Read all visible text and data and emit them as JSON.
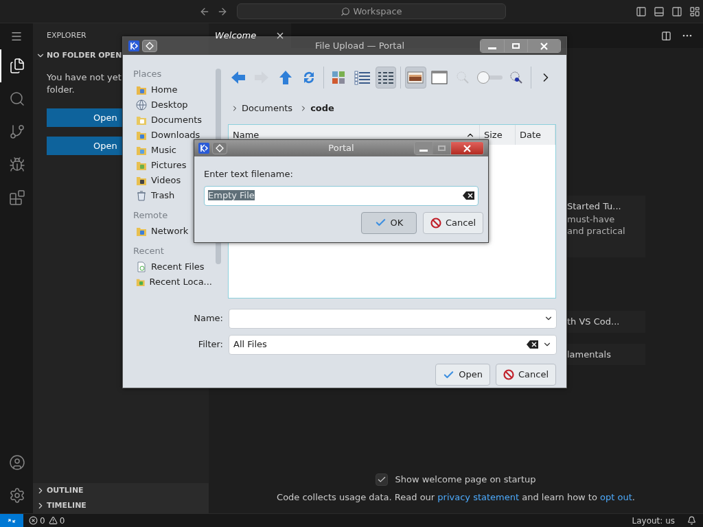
{
  "titlebar": {
    "search": "Workspace"
  },
  "activity_bar": {
    "top": [
      {
        "kind": "explorer",
        "selected": true
      },
      {
        "kind": "search",
        "selected": false
      },
      {
        "kind": "source-control",
        "selected": false
      },
      {
        "kind": "run-debug",
        "selected": false
      },
      {
        "kind": "extensions",
        "selected": false
      }
    ],
    "bottom": [
      {
        "kind": "accounts",
        "selected": false
      },
      {
        "kind": "manage",
        "selected": false
      }
    ]
  },
  "sidebar": {
    "title": "EXPLORER",
    "section": {
      "title": "NO FOLDER OPEN",
      "expanded": true
    },
    "message": "You have not yet folder.",
    "buttons": [
      "Open",
      "Open"
    ],
    "bottom_sections": [
      {
        "title": "OUTLINE",
        "expanded": false
      },
      {
        "title": "TIMELINE",
        "expanded": false
      }
    ]
  },
  "editor": {
    "tabs": [
      {
        "label": "Welcome",
        "selected": true
      }
    ],
    "cards": [
      {
        "title": "Started Tu...",
        "lines": [
          "must-have",
          "and practical"
        ]
      },
      {
        "title": "th VS Cod..."
      },
      {
        "title": "lamentals"
      }
    ],
    "startup_checkbox": {
      "label": "Show welcome page on startup",
      "checked": true
    },
    "footer": [
      {
        "text": "Code collects usage data. Read our ",
        "link": false
      },
      {
        "text": "privacy statement",
        "link": true
      },
      {
        "text": " and learn how to ",
        "link": false
      },
      {
        "text": "opt out",
        "link": true
      },
      {
        "text": ".",
        "link": false
      }
    ]
  },
  "status_bar": {
    "errors": "0",
    "warnings": "0",
    "layout": "Layout: us"
  },
  "file_dialog": {
    "title": "File Upload — Portal",
    "places": [
      {
        "title": "Places",
        "items": [
          {
            "label": "Home",
            "kind": "home"
          },
          {
            "label": "Desktop",
            "kind": "desktop"
          },
          {
            "label": "Documents",
            "kind": "documents"
          },
          {
            "label": "Downloads",
            "kind": "downloads"
          },
          {
            "label": "Music",
            "kind": "music"
          },
          {
            "label": "Pictures",
            "kind": "pictures"
          },
          {
            "label": "Videos",
            "kind": "videos"
          },
          {
            "label": "Trash",
            "kind": "trash"
          }
        ]
      },
      {
        "title": "Remote",
        "items": [
          {
            "label": "Network",
            "kind": "network"
          }
        ]
      },
      {
        "title": "Recent",
        "items": [
          {
            "label": "Recent Files",
            "kind": "recent-files"
          },
          {
            "label": "Recent Loca...",
            "kind": "recent-locations"
          }
        ]
      }
    ],
    "toolbar": [
      {
        "kind": "back",
        "disabled": false,
        "selected": false
      },
      {
        "kind": "forward",
        "disabled": true,
        "selected": false
      },
      {
        "kind": "up",
        "disabled": false,
        "selected": false
      },
      {
        "kind": "reload",
        "disabled": false,
        "selected": false
      },
      {
        "kind": "separator"
      },
      {
        "kind": "icons-view",
        "disabled": false,
        "selected": false
      },
      {
        "kind": "compact-view",
        "disabled": false,
        "selected": false
      },
      {
        "kind": "detail-view",
        "disabled": false,
        "selected": true
      },
      {
        "kind": "separator"
      },
      {
        "kind": "preview",
        "disabled": false,
        "selected": true
      },
      {
        "kind": "panel",
        "disabled": false,
        "selected": false
      },
      {
        "kind": "zoom-out",
        "disabled": true,
        "selected": false
      },
      {
        "kind": "zoom-slider"
      },
      {
        "kind": "zoom-in",
        "disabled": false,
        "selected": false
      },
      {
        "kind": "separator"
      },
      {
        "kind": "more",
        "disabled": false,
        "selected": false
      }
    ],
    "breadcrumb": [
      {
        "label": "Documents",
        "current": false
      },
      {
        "label": "code",
        "current": true
      }
    ],
    "columns": [
      {
        "label": "Name",
        "sorted": true
      },
      {
        "label": "Size",
        "sorted": false
      },
      {
        "label": "Date",
        "sorted": false
      }
    ],
    "name_field": {
      "label": "Name:"
    },
    "filter_field": {
      "label": "Filter:",
      "value": "All Files"
    },
    "buttons": [
      {
        "label": "Open",
        "kind": "ok"
      },
      {
        "label": "Cancel",
        "kind": "cancel"
      }
    ]
  },
  "portal": {
    "title": "Portal",
    "prompt": "Enter text filename:",
    "value": "Empty File",
    "value_selected": true,
    "controls": [
      {
        "kind": "minimize",
        "disabled": false
      },
      {
        "kind": "maximize",
        "disabled": true
      },
      {
        "kind": "close",
        "disabled": false
      }
    ],
    "buttons": [
      {
        "label": "OK",
        "kind": "ok",
        "focused": true
      },
      {
        "label": "Cancel",
        "kind": "cancel",
        "focused": false
      }
    ]
  }
}
